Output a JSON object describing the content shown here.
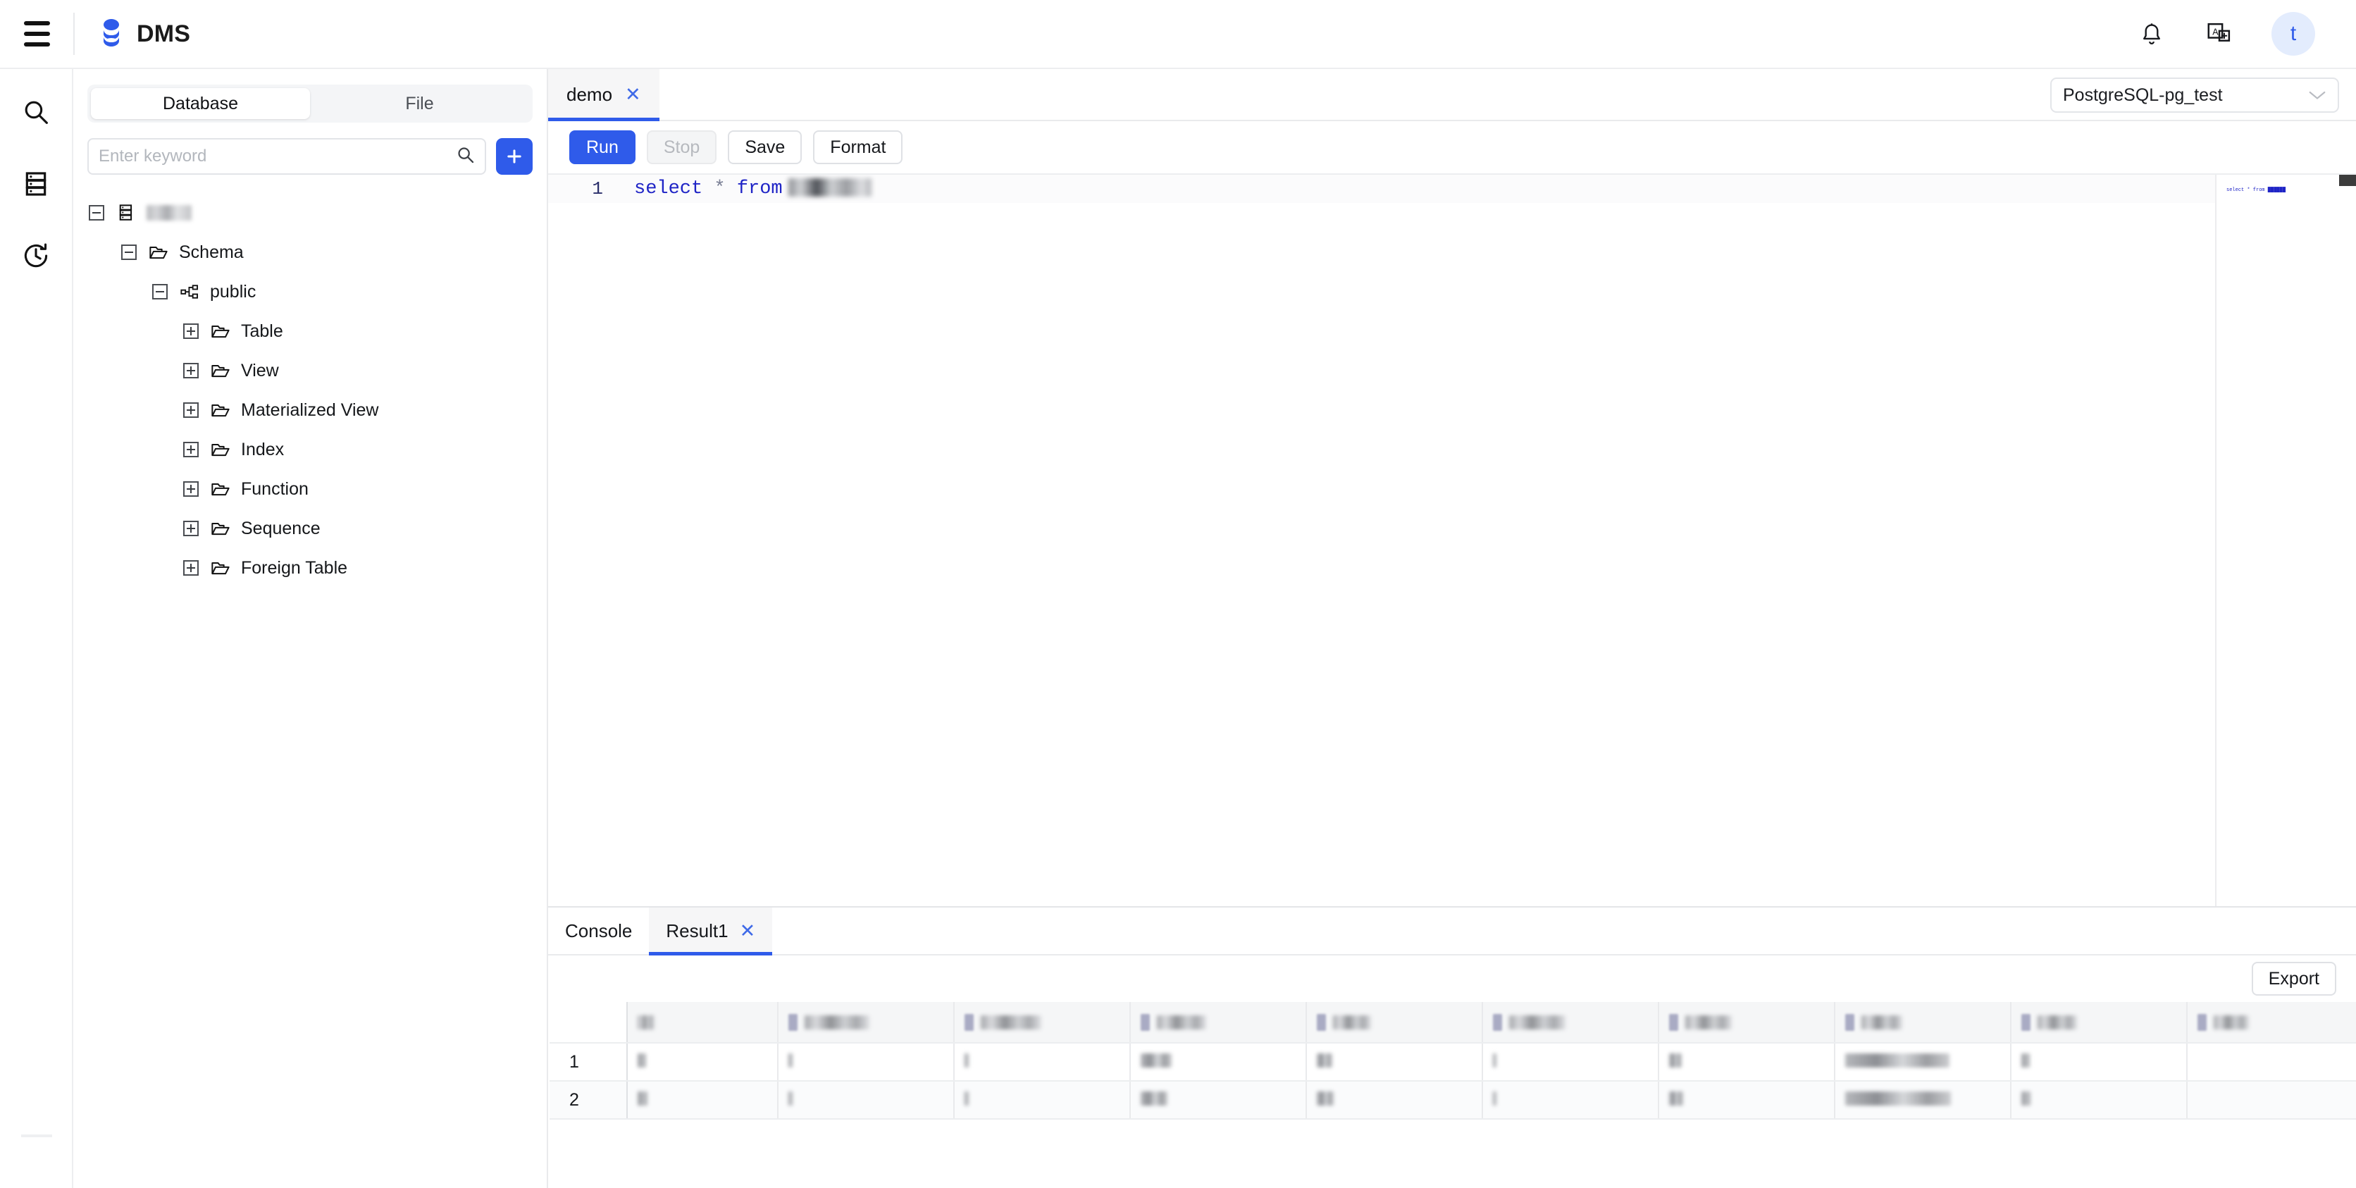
{
  "app": {
    "brand": "DMS",
    "menu_icon": "hamburger-icon",
    "notification_icon": "bell-icon",
    "language_icon": "translate-icon",
    "avatar_initial": "t",
    "accent_color": "#2f5bea"
  },
  "rail": {
    "items": [
      {
        "icon": "search-icon",
        "name": "search"
      },
      {
        "icon": "database-rack-icon",
        "name": "instances"
      },
      {
        "icon": "history-clock-icon",
        "name": "history"
      }
    ]
  },
  "sidebar": {
    "tabs": [
      {
        "label": "Database",
        "active": true
      },
      {
        "label": "File",
        "active": false
      }
    ],
    "search": {
      "placeholder": "Enter keyword",
      "value": "",
      "icon": "search-icon"
    },
    "add_button": {
      "icon": "plus-icon",
      "label": "+"
    },
    "tree": [
      {
        "label": "",
        "redacted": true,
        "icon": "database-rack-icon",
        "state": "expanded",
        "depth": 0
      },
      {
        "label": "Schema",
        "redacted": false,
        "icon": "folder-icon",
        "state": "expanded",
        "depth": 1
      },
      {
        "label": "public",
        "redacted": false,
        "icon": "schema-icon",
        "state": "expanded",
        "depth": 2
      },
      {
        "label": "Table",
        "redacted": false,
        "icon": "folder-icon",
        "state": "collapsed",
        "depth": 3
      },
      {
        "label": "View",
        "redacted": false,
        "icon": "folder-icon",
        "state": "collapsed",
        "depth": 3
      },
      {
        "label": "Materialized View",
        "redacted": false,
        "icon": "folder-icon",
        "state": "collapsed",
        "depth": 3
      },
      {
        "label": "Index",
        "redacted": false,
        "icon": "folder-icon",
        "state": "collapsed",
        "depth": 3
      },
      {
        "label": "Function",
        "redacted": false,
        "icon": "folder-icon",
        "state": "collapsed",
        "depth": 3
      },
      {
        "label": "Sequence",
        "redacted": false,
        "icon": "folder-icon",
        "state": "collapsed",
        "depth": 3
      },
      {
        "label": "Foreign Table",
        "redacted": false,
        "icon": "folder-icon",
        "state": "collapsed",
        "depth": 3
      }
    ]
  },
  "editor": {
    "tabs": [
      {
        "label": "demo",
        "active": true,
        "closable": true
      }
    ],
    "connection": {
      "value": "PostgreSQL-pg_test",
      "icon": "chevron-down-icon"
    },
    "toolbar": {
      "run": "Run",
      "stop": "Stop",
      "save": "Save",
      "format": "Format"
    },
    "code": {
      "line_number": "1",
      "keyword1": "select",
      "operator": "*",
      "keyword2": "from",
      "table_redacted": true
    }
  },
  "results": {
    "tabs": [
      {
        "label": "Console",
        "active": false,
        "closable": false
      },
      {
        "label": "Result1",
        "active": true,
        "closable": true
      }
    ],
    "export_label": "Export",
    "grid": {
      "rownum_header": "",
      "columns": [
        {
          "redacted": true,
          "width": 24
        },
        {
          "redacted": true,
          "width": 92
        },
        {
          "redacted": true,
          "width": 86
        },
        {
          "redacted": true,
          "width": 70
        },
        {
          "redacted": true,
          "width": 54
        },
        {
          "redacted": true,
          "width": 80
        },
        {
          "redacted": true,
          "width": 66
        },
        {
          "redacted": true,
          "width": 58
        },
        {
          "redacted": true,
          "width": 56
        },
        {
          "redacted": true,
          "width": 50
        }
      ],
      "rows": [
        {
          "number": "1",
          "cells": [
            {
              "redacted": true,
              "width": 12
            },
            {
              "redacted": true,
              "width": 6
            },
            {
              "redacted": true,
              "width": 6
            },
            {
              "redacted": true,
              "width": 44
            },
            {
              "redacted": true,
              "width": 22
            },
            {
              "redacted": true,
              "width": 5
            },
            {
              "redacted": true,
              "width": 18
            },
            {
              "redacted": true,
              "width": 148
            },
            {
              "redacted": true,
              "width": 12
            },
            {
              "redacted": false,
              "width": 0
            }
          ]
        },
        {
          "number": "2",
          "cells": [
            {
              "redacted": true,
              "width": 14
            },
            {
              "redacted": true,
              "width": 6
            },
            {
              "redacted": true,
              "width": 6
            },
            {
              "redacted": true,
              "width": 38
            },
            {
              "redacted": true,
              "width": 24
            },
            {
              "redacted": true,
              "width": 5
            },
            {
              "redacted": true,
              "width": 20
            },
            {
              "redacted": true,
              "width": 150
            },
            {
              "redacted": true,
              "width": 13
            },
            {
              "redacted": false,
              "width": 0
            }
          ]
        }
      ]
    }
  }
}
